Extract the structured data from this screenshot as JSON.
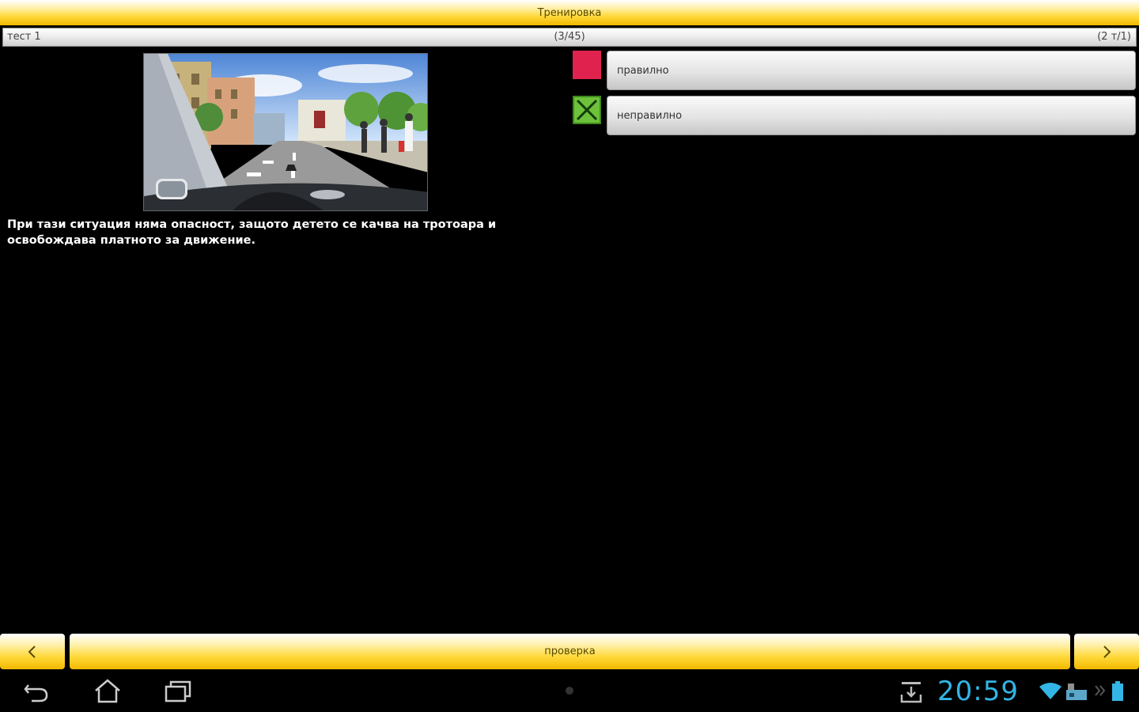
{
  "app": {
    "title": "Тренировка"
  },
  "info": {
    "test_name": "тест 1",
    "progress": "(3/45)",
    "points": "(2 т/1)"
  },
  "question": {
    "text": "При тази ситуация няма опасност, защото детето се качва на тротоара и освобождава платното за движение."
  },
  "answers": [
    {
      "label": "правилно",
      "marker_color": "#e0234e",
      "marker": "selected-red-square"
    },
    {
      "label": "неправилно",
      "marker_color": "#6ec13a",
      "marker": "green-x-box"
    }
  ],
  "bottom": {
    "prev_icon": "chevron-left-icon",
    "check_label": "проверка",
    "next_icon": "chevron-right-icon"
  },
  "system_bar": {
    "time": "20:59",
    "icons": [
      "back-icon",
      "home-icon",
      "recent-apps-icon",
      "download-icon",
      "wifi-icon",
      "storage-icon",
      "battery-icon"
    ]
  },
  "colors": {
    "accent_yellow": "#ffd93a",
    "clock_blue": "#33b5e5"
  }
}
